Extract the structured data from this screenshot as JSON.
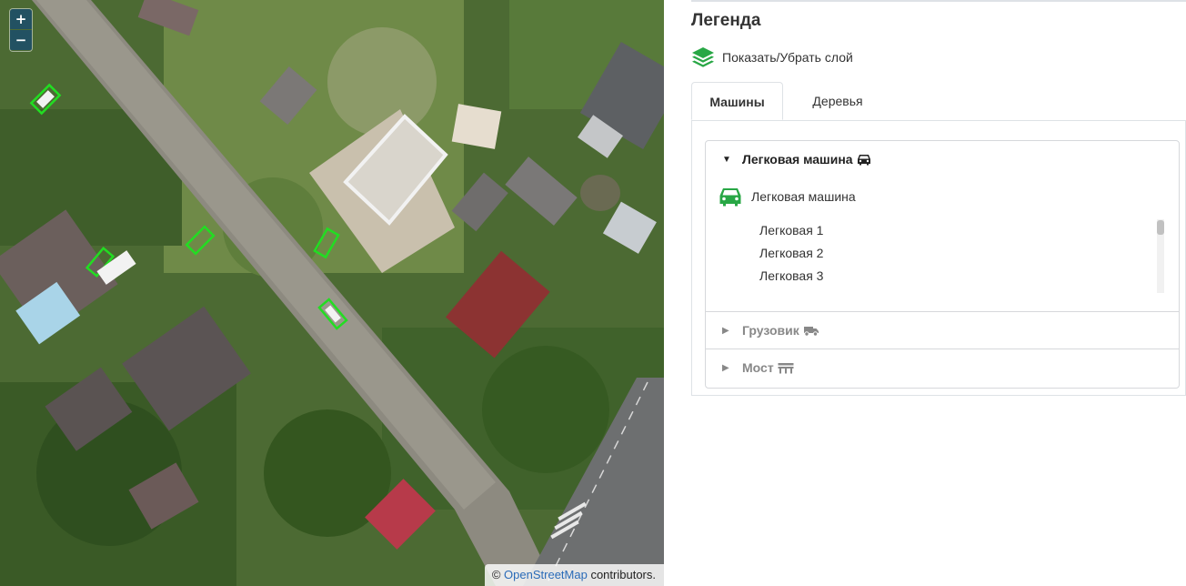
{
  "map": {
    "zoom_in_label": "+",
    "zoom_out_label": "−",
    "attribution": {
      "prefix": "©",
      "link_text": "OpenStreetMap",
      "suffix": "contributors."
    },
    "detection_box_color": "#22dd22"
  },
  "legend": {
    "title": "Легенда",
    "layer_toggle_label": "Показать/Убрать слой",
    "accent_color": "#28a745",
    "icons": {
      "layers": "layers-icon",
      "car": "car-icon",
      "truck": "truck-icon",
      "bridge": "bridge-icon"
    },
    "tabs": [
      {
        "label": "Машины",
        "active": true
      },
      {
        "label": "Деревья",
        "active": false
      }
    ],
    "sections": [
      {
        "title": "Легковая машина",
        "expanded": true,
        "class_label": "Легковая машина",
        "items": [
          "Легковая 1",
          "Легковая 2",
          "Легковая 3"
        ]
      },
      {
        "title": "Грузовик",
        "expanded": false
      },
      {
        "title": "Мост",
        "expanded": false
      }
    ]
  }
}
